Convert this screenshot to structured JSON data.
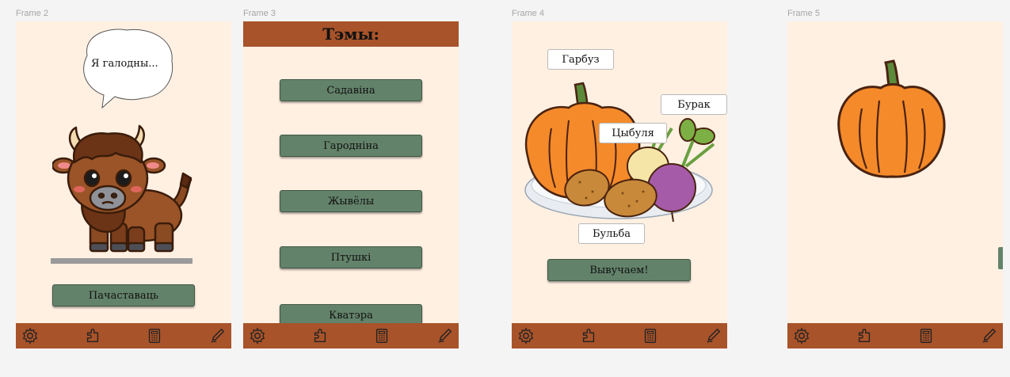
{
  "frames": {
    "f2": {
      "label": "Frame 2",
      "speech": "Я галодны...",
      "start_button": "Пачаставаць"
    },
    "f3": {
      "label": "Frame 3",
      "title": "Тэмы:",
      "topics": [
        "Садавіна",
        "Гароднiна",
        "Жывёлы",
        "Птушкі",
        "Кватэра"
      ]
    },
    "f4": {
      "label": "Frame 4",
      "words": {
        "pumpkin": "Гарбуз",
        "beet": "Бурак",
        "onion": "Цыбуля",
        "potato": "Бульба"
      },
      "learn_button": "Вывучаем!"
    },
    "f5": {
      "label": "Frame 5"
    }
  },
  "navbar": {
    "icons": [
      "gear-icon",
      "puzzle-icon",
      "calculator-icon",
      "pen-icon"
    ]
  },
  "colors": {
    "background": "#fff0e2",
    "bar": "#a8532a",
    "button": "#63826a",
    "pumpkin": "#f58a2a",
    "bison": "#8a4a22"
  }
}
